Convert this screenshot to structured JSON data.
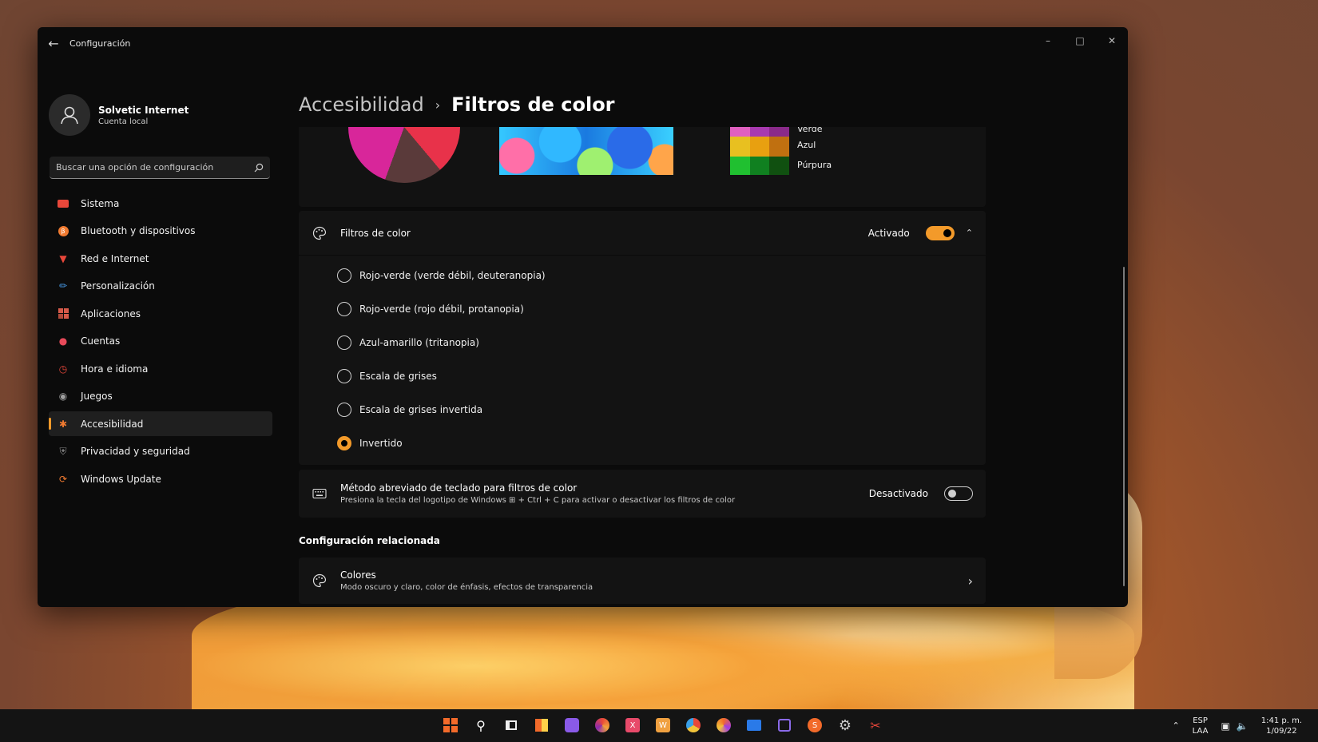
{
  "window": {
    "title": "Configuración"
  },
  "profile": {
    "name": "Solvetic Internet",
    "account_type": "Cuenta local"
  },
  "search": {
    "placeholder": "Buscar una opción de configuración"
  },
  "sidebar": {
    "items": [
      {
        "label": "Sistema",
        "icon": "monitor-icon",
        "color": "#e8473a"
      },
      {
        "label": "Bluetooth y dispositivos",
        "icon": "bluetooth-icon",
        "color": "#f07a30"
      },
      {
        "label": "Red e Internet",
        "icon": "wifi-icon",
        "color": "#e8473a"
      },
      {
        "label": "Personalización",
        "icon": "brush-icon",
        "color": "#4aa0f0"
      },
      {
        "label": "Aplicaciones",
        "icon": "apps-icon",
        "color": "#d65a4a"
      },
      {
        "label": "Cuentas",
        "icon": "person-icon",
        "color": "#e84a5a"
      },
      {
        "label": "Hora e idioma",
        "icon": "globe-clock-icon",
        "color": "#e8473a"
      },
      {
        "label": "Juegos",
        "icon": "gamepad-icon",
        "color": "#a0a0a0"
      },
      {
        "label": "Accesibilidad",
        "icon": "accessibility-icon",
        "color": "#f07a30",
        "active": true
      },
      {
        "label": "Privacidad y seguridad",
        "icon": "shield-icon",
        "color": "#8a8a8a"
      },
      {
        "label": "Windows Update",
        "icon": "update-icon",
        "color": "#f07a30"
      }
    ]
  },
  "breadcrumb": {
    "parent": "Accesibilidad",
    "current": "Filtros de color"
  },
  "preview": {
    "swatch_labels": [
      "Verde",
      "Azul",
      "Púrpura"
    ],
    "swatch_colors": [
      "#e060c0",
      "#a83ab0",
      "#8a2a8a",
      "#e8c020",
      "#e8a010",
      "#c07010",
      "#20c030",
      "#108020",
      "#105010"
    ]
  },
  "color_filters": {
    "title": "Filtros de color",
    "state": "Activado",
    "options": [
      {
        "label": "Rojo-verde (verde débil, deuteranopia)",
        "selected": false
      },
      {
        "label": "Rojo-verde (rojo débil, protanopia)",
        "selected": false
      },
      {
        "label": "Azul-amarillo (tritanopia)",
        "selected": false
      },
      {
        "label": "Escala de grises",
        "selected": false
      },
      {
        "label": "Escala de grises invertida",
        "selected": false
      },
      {
        "label": "Invertido",
        "selected": true
      }
    ]
  },
  "shortcut": {
    "title": "Método abreviado de teclado para filtros de color",
    "description": "Presiona la tecla del logotipo de Windows ⊞ + Ctrl + C para activar o desactivar los filtros de color",
    "state": "Desactivado"
  },
  "related": {
    "section_title": "Configuración relacionada",
    "colors_title": "Colores",
    "colors_description": "Modo oscuro y claro, color de énfasis, efectos de transparencia"
  },
  "taskbar": {
    "lang_line1": "ESP",
    "lang_line2": "LAA",
    "time": "1:41 p. m.",
    "date": "1/09/22"
  },
  "colors": {
    "accent": "#f39a2a",
    "window_bg": "#0b0b0b",
    "card_bg": "#131313"
  }
}
